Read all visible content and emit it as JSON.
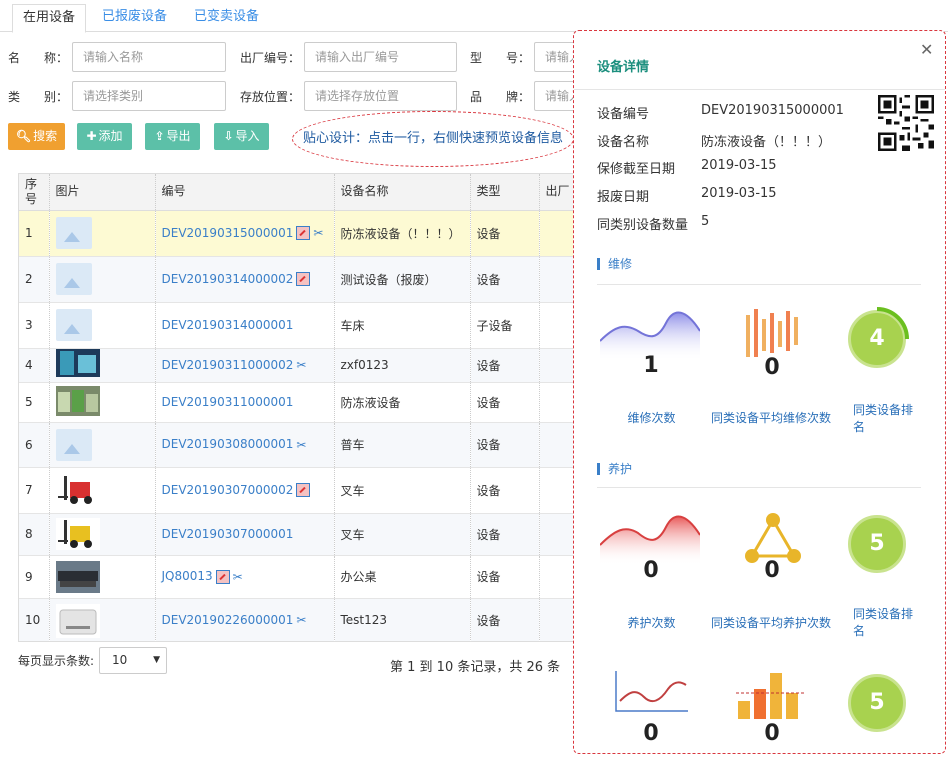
{
  "tabs": [
    "在用设备",
    "已报废设备",
    "已变卖设备"
  ],
  "filters": {
    "name_label": "名　　称：",
    "name_placeholder": "请输入名称",
    "serial_label": "出厂编号：",
    "serial_placeholder": "请输入出厂编号",
    "model_label": "型　　号：",
    "model_placeholder": "请输入",
    "category_label": "类　　别：",
    "category_placeholder": "请选择类别",
    "location_label": "存放位置：",
    "location_placeholder": "请选择存放位置",
    "brand_label": "品　　牌：",
    "brand_placeholder": "请输入"
  },
  "toolbar": {
    "search": "搜索",
    "add": "添加",
    "export": "导出",
    "import": "导入",
    "tip": "贴心设计：点击一行，右侧快速预览设备信息"
  },
  "table": {
    "headers": [
      "序号",
      "图片",
      "编号",
      "设备名称",
      "类型",
      "出厂"
    ],
    "rows": [
      {
        "idx": "1",
        "code": "DEV20190315000001",
        "name": "防冻液设备（！！！）",
        "type": "设备",
        "img": "ph",
        "rep": true,
        "tool": true
      },
      {
        "idx": "2",
        "code": "DEV20190314000002",
        "name": "测试设备（报废）",
        "type": "设备",
        "img": "ph",
        "rep": true,
        "tool": false
      },
      {
        "idx": "3",
        "code": "DEV20190314000001",
        "name": "车床",
        "type": "子设备",
        "img": "ph",
        "rep": false,
        "tool": false
      },
      {
        "idx": "4",
        "code": "DEV20190311000002",
        "name": "zxf0123",
        "type": "设备",
        "img": "photo1",
        "rep": false,
        "tool": true
      },
      {
        "idx": "5",
        "code": "DEV20190311000001",
        "name": "防冻液设备",
        "type": "设备",
        "img": "photo2",
        "rep": false,
        "tool": false
      },
      {
        "idx": "6",
        "code": "DEV20190308000001",
        "name": "普车",
        "type": "设备",
        "img": "ph",
        "rep": false,
        "tool": true
      },
      {
        "idx": "7",
        "code": "DEV20190307000002",
        "name": "叉车",
        "type": "设备",
        "img": "forklift-red",
        "rep": true,
        "tool": false
      },
      {
        "idx": "8",
        "code": "DEV20190307000001",
        "name": "叉车",
        "type": "设备",
        "img": "forklift-yellow",
        "rep": false,
        "tool": false
      },
      {
        "idx": "9",
        "code": "JQ80013",
        "name": "办公桌",
        "type": "设备",
        "img": "desk",
        "rep": true,
        "tool": true
      },
      {
        "idx": "10",
        "code": "DEV20190226000001",
        "name": "Test123",
        "type": "设备",
        "img": "printer",
        "rep": false,
        "tool": true
      }
    ]
  },
  "pager": {
    "label": "每页显示条数:",
    "size": "10",
    "info": "第 1 到 10 条记录，共 26 条"
  },
  "panel": {
    "title": "设备详情",
    "fields": [
      {
        "k": "设备编号",
        "v": "DEV20190315000001"
      },
      {
        "k": "设备名称",
        "v": "防冻液设备（！！！）"
      },
      {
        "k": "保修截至日期",
        "v": "2019-03-15"
      },
      {
        "k": "报废日期",
        "v": "2019-03-15"
      },
      {
        "k": "同类别设备数量",
        "v": "5"
      }
    ],
    "repair": {
      "title": "维修",
      "count": "1",
      "count_label": "维修次数",
      "avg": "0",
      "avg_label": "同类设备平均维修次数",
      "rank": "4",
      "rank_label": "同类设备排名",
      "rank_fill": 0.25
    },
    "maint": {
      "title": "养护",
      "count": "0",
      "count_label": "养护次数",
      "avg": "0",
      "avg_label": "同类设备平均养护次数",
      "rank": "5",
      "rank_label": "同类设备排名"
    },
    "extra": {
      "a": "0",
      "b": "0",
      "rank": "5"
    }
  },
  "colors": {
    "accent": "#3a7fc8",
    "teal": "#1c8f7e",
    "orange": "#f0a030",
    "green": "#a8d24f",
    "red": "#d9363e"
  }
}
